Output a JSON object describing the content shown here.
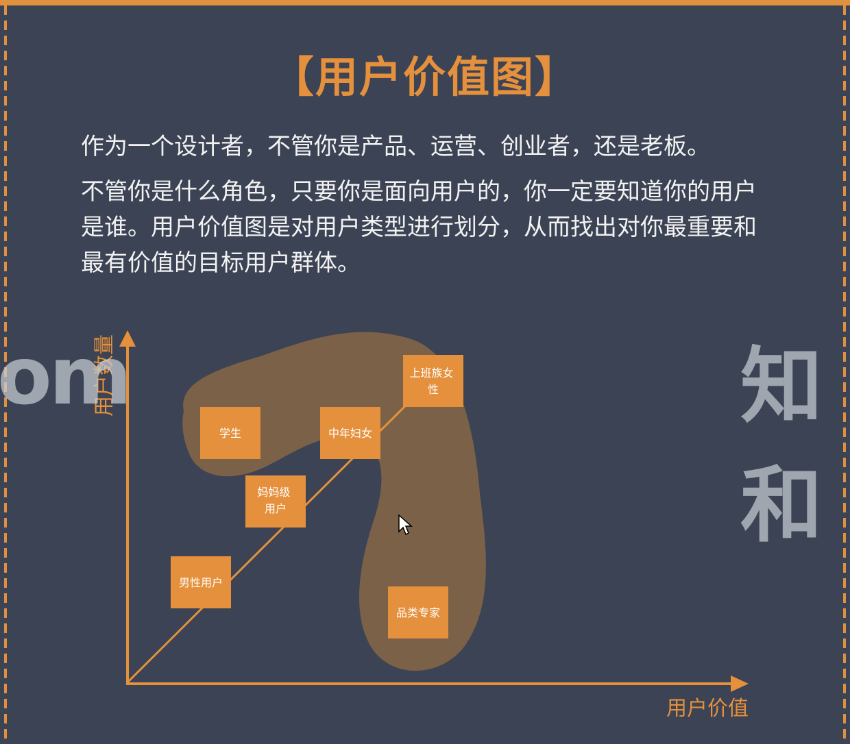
{
  "title": "【用户价值图】",
  "paragraphs": [
    "作为一个设计者，不管你是产品、运营、创业者，还是老板。",
    "不管你是什么角色，只要你是面向用户的，你一定要知道你的用户是谁。用户价值图是对用户类型进行划分，从而找出对你最重要和最有价值的目标用户群体。"
  ],
  "watermarks": {
    "left": "om",
    "right": "知和"
  },
  "diagram": {
    "y_axis_label": "用户数量",
    "x_axis_label": "用户价值",
    "nodes": [
      {
        "label": "学生"
      },
      {
        "label": "中年妇女"
      },
      {
        "label": "上班族女性"
      },
      {
        "label": "妈妈级用户"
      },
      {
        "label": "男性用户"
      },
      {
        "label": "品类专家"
      }
    ]
  },
  "colors": {
    "background": "#3b4354",
    "accent": "#e5903c",
    "blob": "#7a6148",
    "text": "#f2f2f2"
  }
}
